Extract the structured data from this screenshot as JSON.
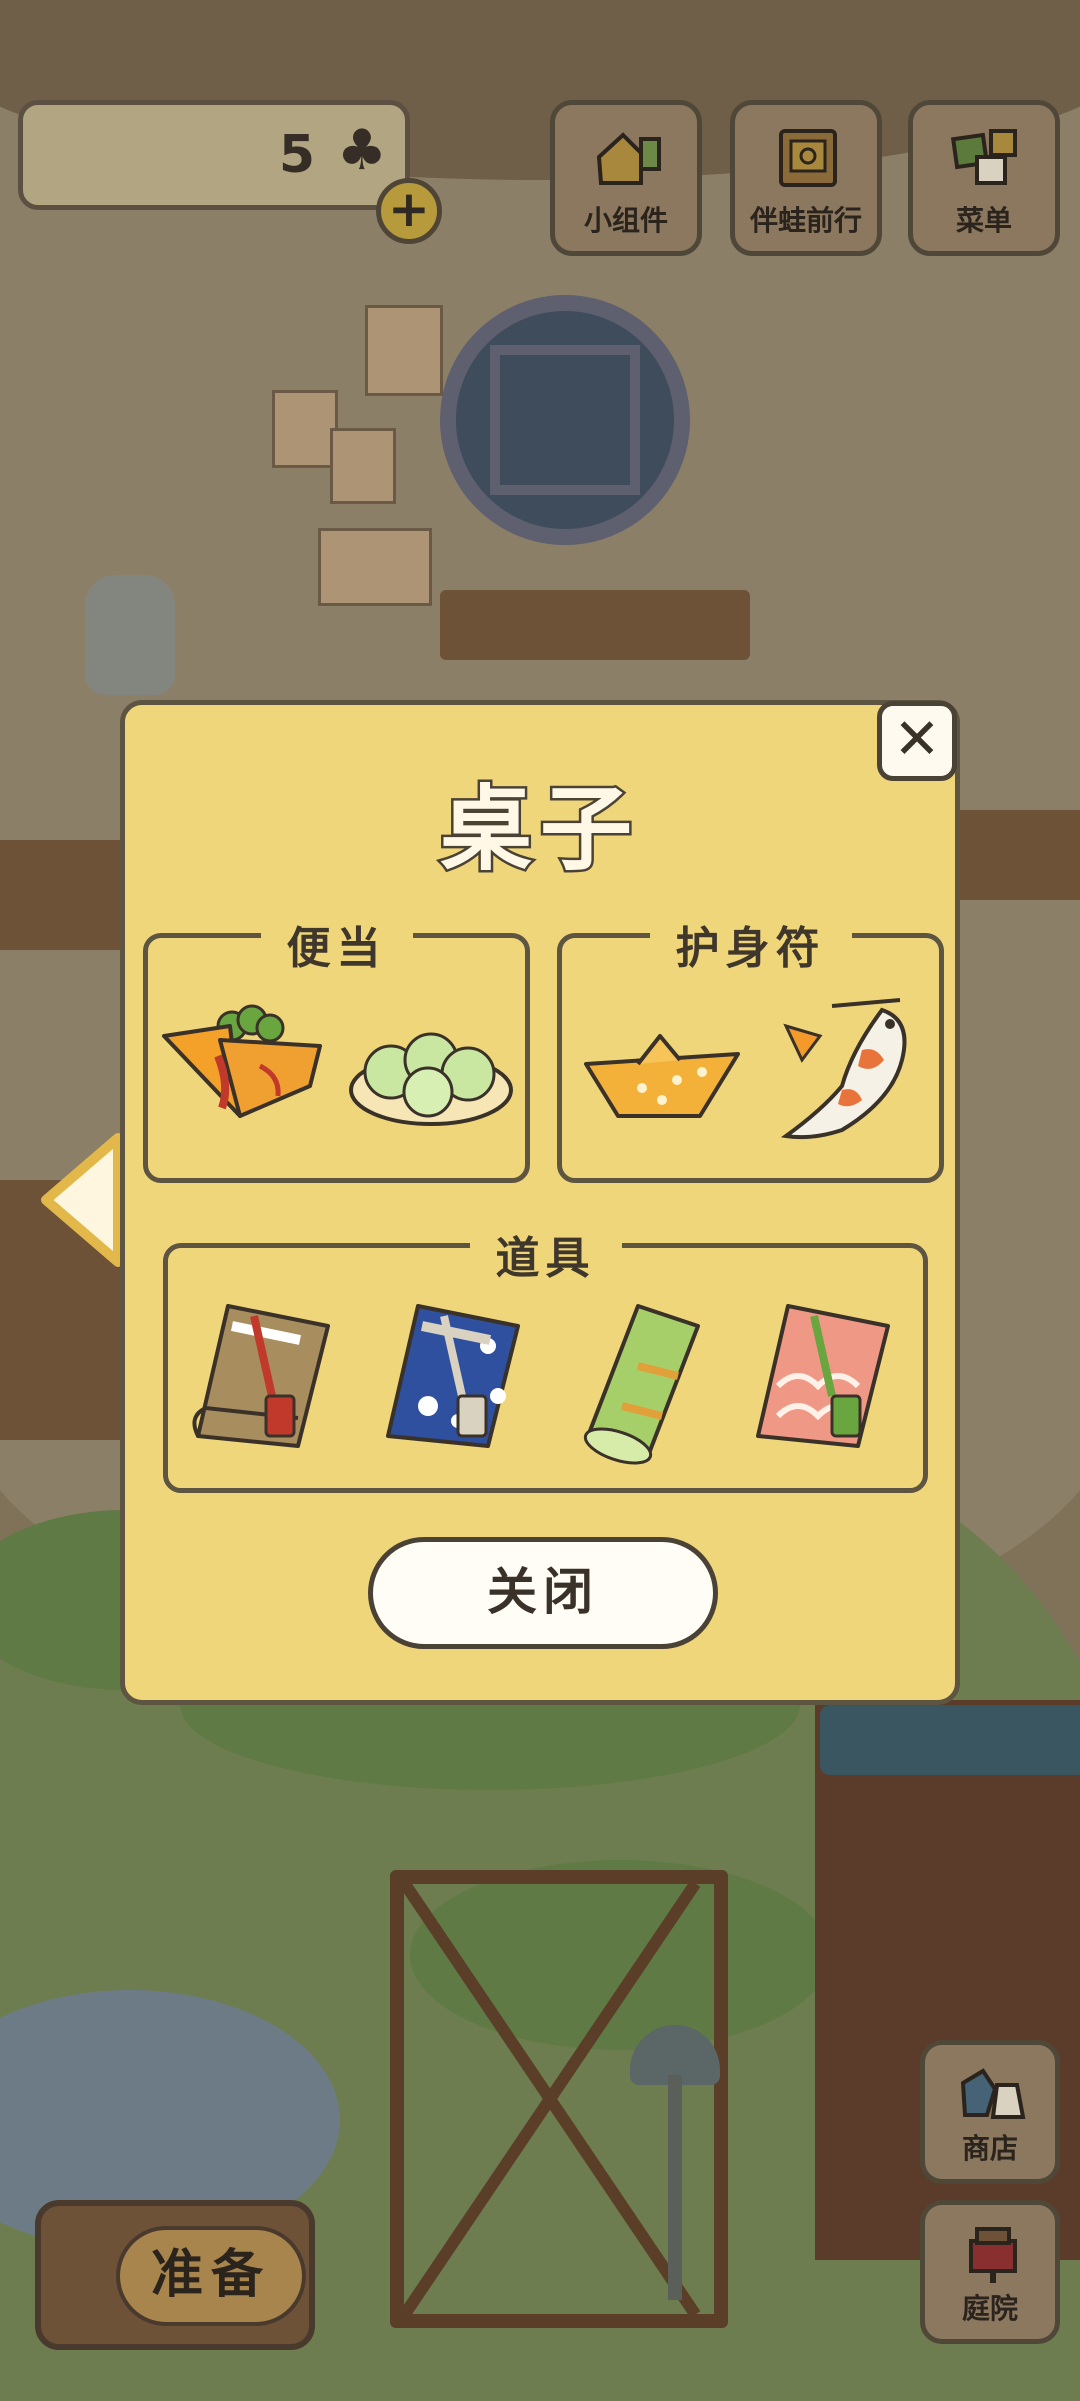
{
  "hud": {
    "clover_count": "5",
    "clover_icon": "♣",
    "plus_icon": "+"
  },
  "top_buttons": [
    {
      "label": "小组件",
      "icon": "widget-icon"
    },
    {
      "label": "伴蛙前行",
      "icon": "travel-companion-icon"
    },
    {
      "label": "菜单",
      "icon": "menu-icon"
    }
  ],
  "side_buttons": [
    {
      "label": "商店",
      "icon": "shop-icon"
    },
    {
      "label": "庭院",
      "icon": "garden-icon"
    }
  ],
  "prepare_button": {
    "label": "准备"
  },
  "modal": {
    "title": "桌子",
    "close_icon": "✕",
    "sections": [
      {
        "label": "便当",
        "items": [
          "bento-omelette-rice-icon",
          "bento-dumplings-icon"
        ]
      },
      {
        "label": "护身符",
        "items": [
          "paper-boat-charm-icon",
          "koi-fish-charm-icon"
        ]
      },
      {
        "label": "道具",
        "items": [
          "tan-bedroll-icon",
          "blue-floral-bedroll-icon",
          "green-bedroll-icon",
          "pink-cloud-bedroll-icon"
        ]
      }
    ],
    "close_button": "关闭"
  },
  "colors": {
    "modal_bg": "#f0d67a",
    "outline": "#4b4236",
    "button_bg": "#fffdf6"
  }
}
